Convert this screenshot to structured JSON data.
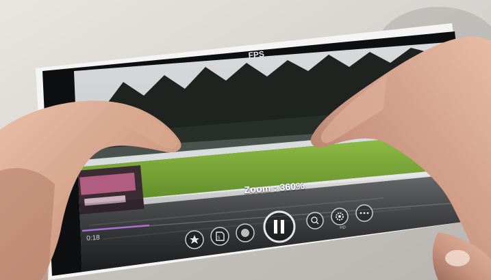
{
  "video": {
    "zoom_text": "Zoom : 360%",
    "fps_label": "FPS",
    "elapsed_time": "0:18",
    "hd_label": "HD"
  },
  "controls": [
    "star-icon",
    "sd-card-icon",
    "record-icon",
    "pause-icon",
    "zoom-icon",
    "settings-icon",
    "more-icon"
  ],
  "colors": {
    "accent": "#b06fd8",
    "background": "#d8d6d2",
    "phone_body": "#f2f2f2",
    "grass": "#7cab38"
  }
}
